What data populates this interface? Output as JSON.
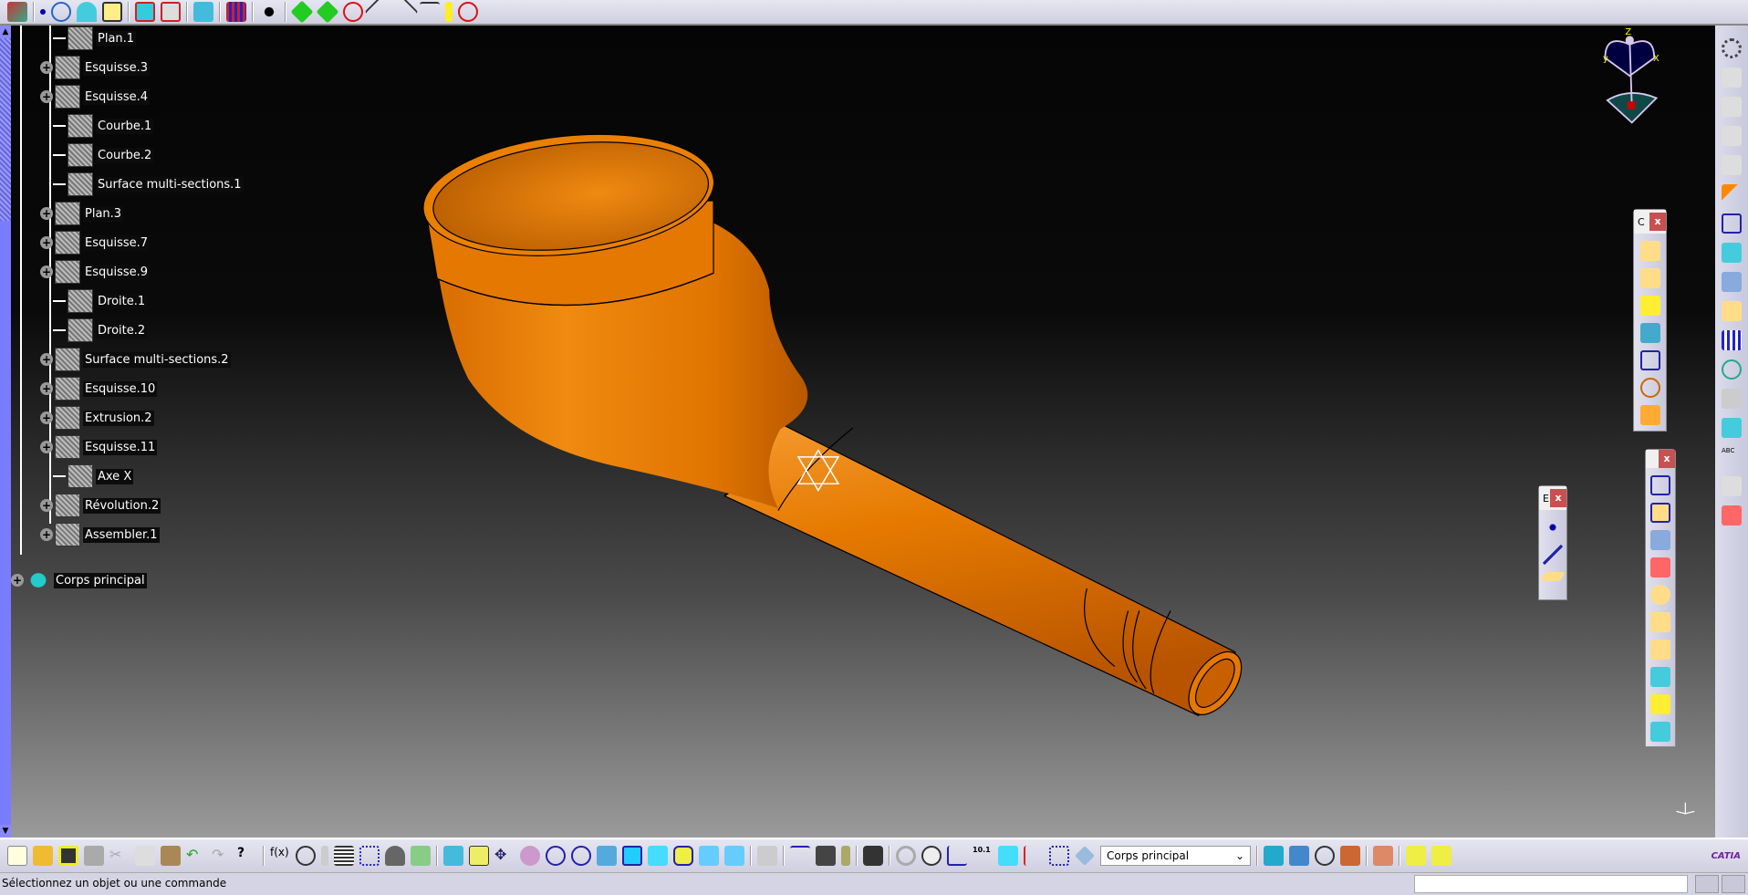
{
  "tree": {
    "items": [
      {
        "label": "Plan.1",
        "expand": false
      },
      {
        "label": "Esquisse.3",
        "expand": true
      },
      {
        "label": "Esquisse.4",
        "expand": true
      },
      {
        "label": "Courbe.1",
        "expand": false
      },
      {
        "label": "Courbe.2",
        "expand": false
      },
      {
        "label": "Surface multi-sections.1",
        "expand": false
      },
      {
        "label": "Plan.3",
        "expand": true
      },
      {
        "label": "Esquisse.7",
        "expand": true
      },
      {
        "label": "Esquisse.9",
        "expand": true
      },
      {
        "label": "Droite.1",
        "expand": false
      },
      {
        "label": "Droite.2",
        "expand": false
      },
      {
        "label": "Surface multi-sections.2",
        "expand": true
      },
      {
        "label": "Esquisse.10",
        "expand": true
      },
      {
        "label": "Extrusion.2",
        "expand": true
      },
      {
        "label": "Esquisse.11",
        "expand": true
      },
      {
        "label": "Axe X",
        "expand": false
      },
      {
        "label": "Révolution.2",
        "expand": true
      },
      {
        "label": "Assembler.1",
        "expand": true
      }
    ],
    "root": "Corps principal"
  },
  "compass": {
    "z": "Z",
    "x": "X",
    "y": "y"
  },
  "toolbar_bottom": {
    "current_body": "Corps principal"
  },
  "floating": {
    "c_title": "C",
    "e_title": "E",
    "close": "x"
  },
  "status": {
    "message": "Sélectionnez un objet ou une commande"
  },
  "brand": {
    "logo": "CATIA"
  },
  "colors": {
    "part": "#e87800",
    "background_top": "#050505",
    "background_bottom": "#9a9a9a",
    "scrollbar": "#7b7bff"
  }
}
